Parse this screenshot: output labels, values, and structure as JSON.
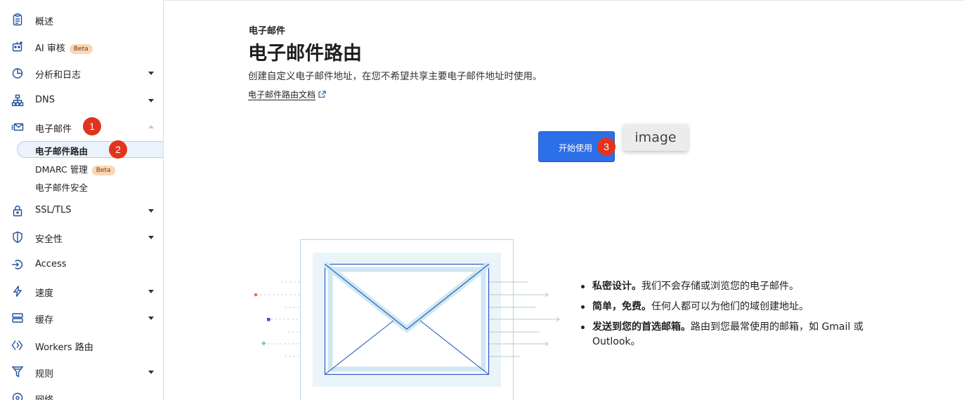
{
  "sidebar": {
    "items": [
      {
        "label": "概述",
        "icon": "clipboard-icon"
      },
      {
        "label": "AI 审核",
        "icon": "robot-icon",
        "badge": "Beta"
      },
      {
        "label": "分析和日志",
        "icon": "pie-chart-icon"
      },
      {
        "label": "DNS",
        "icon": "network-icon"
      },
      {
        "label": "电子邮件",
        "icon": "envelope-icon"
      },
      {
        "label": "SSL/TLS",
        "icon": "lock-icon"
      },
      {
        "label": "安全性",
        "icon": "shield-icon"
      },
      {
        "label": "Access",
        "icon": "access-icon"
      },
      {
        "label": "速度",
        "icon": "bolt-icon"
      },
      {
        "label": "缓存",
        "icon": "storage-icon"
      },
      {
        "label": "Workers 路由",
        "icon": "workers-icon"
      },
      {
        "label": "规则",
        "icon": "funnel-icon"
      },
      {
        "label": "网络",
        "icon": "globe-icon"
      }
    ],
    "email_sub": [
      {
        "label": "电子邮件路由"
      },
      {
        "label": "DMARC 管理",
        "badge": "Beta"
      },
      {
        "label": "电子邮件安全"
      }
    ]
  },
  "steps": [
    "1",
    "2",
    "3"
  ],
  "main": {
    "eyebrow": "电子邮件",
    "title": "电子邮件路由",
    "description": "创建自定义电子邮件地址，在您不希望共享主要电子邮件地址时使用。",
    "doc_link": "电子邮件路由文档",
    "start_button": "开始使用",
    "tooltip": "image",
    "features": [
      {
        "bold": "私密设计。",
        "text": "我们不会存储或浏览您的电子邮件。"
      },
      {
        "bold": "简单，免费。",
        "text": "任何人都可以为他们的域创建地址。"
      },
      {
        "bold": "发送到您的首选邮箱。",
        "text": "路由到您最常使用的邮箱，如 Gmail 或 Outlook。"
      }
    ]
  },
  "colors": {
    "accent": "#2d6fe6",
    "step_badge": "#e2341d",
    "beta_badge": "#fbd6b4",
    "active_bg": "#eaf2fb",
    "icon_blue": "#1d4f9c"
  }
}
